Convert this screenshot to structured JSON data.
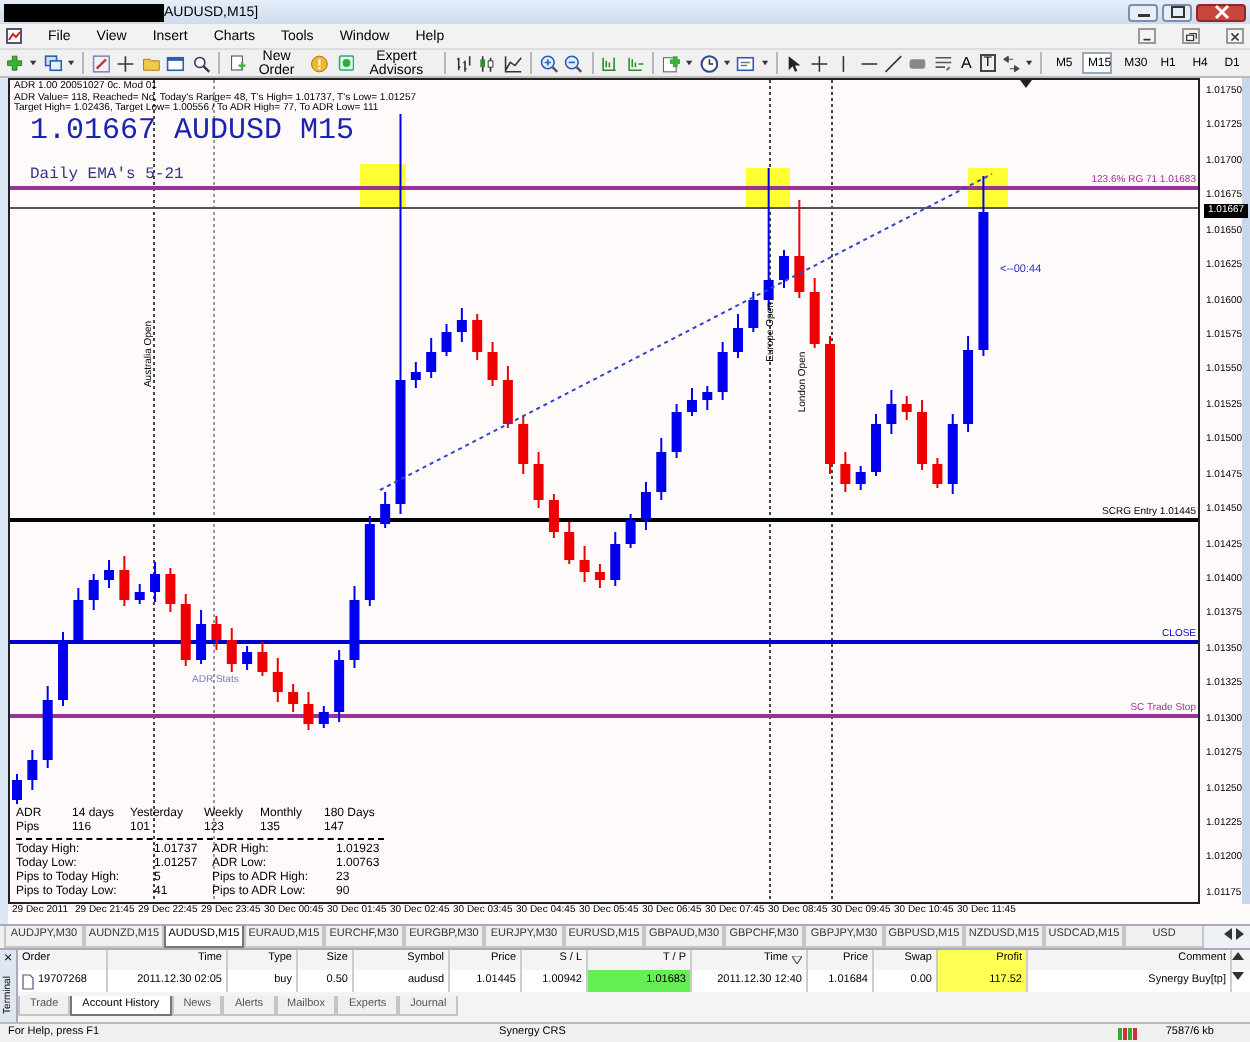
{
  "window": {
    "title": "AUDUSD,M15]"
  },
  "menu": [
    "File",
    "View",
    "Insert",
    "Charts",
    "Tools",
    "Window",
    "Help"
  ],
  "toolbar": {
    "buttons": [
      "New Order",
      "Expert Advisors"
    ],
    "text_tools": [
      "A",
      "T"
    ],
    "timeframes": [
      {
        "label": "M5",
        "selected": false
      },
      {
        "label": "M15",
        "selected": true
      },
      {
        "label": "M30",
        "selected": false
      },
      {
        "label": "H1",
        "selected": false
      },
      {
        "label": "H4",
        "selected": false
      },
      {
        "label": "D1",
        "selected": false
      }
    ]
  },
  "chart": {
    "info_lines": [
      "ADR 1.00 20051027 0c. Mod 01",
      "ADR Value= 118, Reached= No, Today's Range= 48, T's High= 1.01737, T's Low= 1.01257",
      "Target High= 1.02436, Target Low= 1.00556 / To ADR High= 77, To ADR Low= 111"
    ],
    "headline": "1.01667 AUDUSD M15",
    "subtitle": "Daily EMA's 5-21",
    "current_price": "1.01667",
    "countdown": "<--00:44",
    "stats_label": "ADR Stats",
    "levels": [
      {
        "label": "123.6% RG 71 1.01683",
        "color": "#993399"
      },
      {
        "label": "SCRG Entry 1.01445",
        "color": "#000000"
      },
      {
        "label": "CLOSE",
        "color": "#0000cc"
      },
      {
        "label": "SC Trade Stop",
        "color": "#993399"
      }
    ],
    "sessions": [
      "Australia Open",
      "Europe Open",
      "London Open"
    ],
    "price_axis": [
      "1.01750",
      "1.01725",
      "1.01700",
      "1.01675",
      "1.01650",
      "1.01625",
      "1.01600",
      "1.01575",
      "1.01550",
      "1.01525",
      "1.01500",
      "1.01475",
      "1.01450",
      "1.01425",
      "1.01400",
      "1.01375",
      "1.01350",
      "1.01325",
      "1.01300",
      "1.01275",
      "1.01250",
      "1.01225",
      "1.01200",
      "1.01175"
    ],
    "time_axis": [
      "29 Dec 2011",
      "29 Dec 21:45",
      "29 Dec 22:45",
      "29 Dec 23:45",
      "30 Dec 00:45",
      "30 Dec 01:45",
      "30 Dec 02:45",
      "30 Dec 03:45",
      "30 Dec 04:45",
      "30 Dec 05:45",
      "30 Dec 06:45",
      "30 Dec 07:45",
      "30 Dec 08:45",
      "30 Dec 09:45",
      "30 Dec 10:45",
      "30 Dec 11:45"
    ],
    "adr_table": {
      "header": [
        "ADR",
        "14 days",
        "Yesterday",
        "Weekly",
        "Monthly",
        "180 Days"
      ],
      "pips": [
        "Pips",
        "116",
        "101",
        "123",
        "135",
        "147"
      ],
      "details": [
        [
          "Today High:",
          "1.01737",
          "ADR High:",
          "1.01923"
        ],
        [
          "Today Low:",
          "1.01257",
          "ADR Low:",
          "1.00763"
        ],
        [
          "Pips to Today High:",
          "5",
          "Pips to ADR High:",
          "23"
        ],
        [
          "Pips to Today Low:",
          "41",
          "Pips to ADR Low:",
          "90"
        ]
      ]
    }
  },
  "symbol_tabs": [
    {
      "label": "AUDJPY,M30",
      "selected": false
    },
    {
      "label": "AUDNZD,M15",
      "selected": false
    },
    {
      "label": "AUDUSD,M15",
      "selected": true
    },
    {
      "label": "EURAUD,M15",
      "selected": false
    },
    {
      "label": "EURCHF,M30",
      "selected": false
    },
    {
      "label": "EURGBP,M30",
      "selected": false
    },
    {
      "label": "EURJPY,M30",
      "selected": false
    },
    {
      "label": "EURUSD,M15",
      "selected": false
    },
    {
      "label": "GBPAUD,M30",
      "selected": false
    },
    {
      "label": "GBPCHF,M30",
      "selected": false
    },
    {
      "label": "GBPJPY,M30",
      "selected": false
    },
    {
      "label": "GBPUSD,M15",
      "selected": false
    },
    {
      "label": "NZDUSD,M15",
      "selected": false
    },
    {
      "label": "USDCAD,M15",
      "selected": false
    },
    {
      "label": "USD",
      "selected": false
    }
  ],
  "terminal": {
    "title": "Terminal",
    "close": "×",
    "columns": [
      {
        "label": "Order"
      },
      {
        "label": "Time"
      },
      {
        "label": "Type"
      },
      {
        "label": "Size"
      },
      {
        "label": "Symbol"
      },
      {
        "label": "Price"
      },
      {
        "label": "S / L"
      },
      {
        "label": "T / P"
      },
      {
        "label": "Time",
        "sorted": true
      },
      {
        "label": "Price"
      },
      {
        "label": "Swap"
      },
      {
        "label": "Profit",
        "color": "#ffff55"
      },
      {
        "label": "Comment"
      }
    ],
    "rows": [
      [
        {
          "text": "19707268"
        },
        {
          "text": "2011.12.30 02:05"
        },
        {
          "text": "buy"
        },
        {
          "text": "0.50"
        },
        {
          "text": "audusd"
        },
        {
          "text": "1.01445"
        },
        {
          "text": "1.00942"
        },
        {
          "text": "1.01683",
          "color": "#66ee55"
        },
        {
          "text": "2011.12.30 12:40"
        },
        {
          "text": "1.01684"
        },
        {
          "text": "0.00"
        },
        {
          "text": "117.52",
          "color": "#ffff55"
        },
        {
          "text": "Synergy Buy[tp]"
        }
      ]
    ],
    "tabs": [
      {
        "label": "Trade",
        "selected": false
      },
      {
        "label": "Account History",
        "selected": true
      },
      {
        "label": "News",
        "selected": false
      },
      {
        "label": "Alerts",
        "selected": false
      },
      {
        "label": "Mailbox",
        "selected": false
      },
      {
        "label": "Experts",
        "selected": false
      },
      {
        "label": "Journal",
        "selected": false
      }
    ]
  },
  "status_bar": [
    "For Help, press F1",
    "Synergy CRS",
    "7587/6 kb"
  ]
}
